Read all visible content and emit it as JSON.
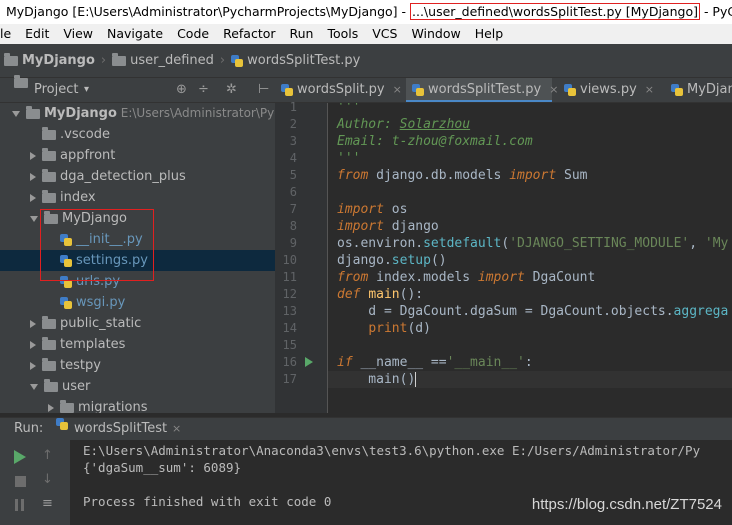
{
  "window": {
    "title_prefix": "MyDjango [E:\\Users\\Administrator\\PycharmProjects\\MyDjango] - ",
    "title_highlight": "...\\user_defined\\wordsSplitTest.py [MyDjango]",
    "title_suffix": " - PyCharm"
  },
  "menu": [
    "le",
    "Edit",
    "View",
    "Navigate",
    "Code",
    "Refactor",
    "Run",
    "Tools",
    "VCS",
    "Window",
    "Help"
  ],
  "breadcrumb": [
    "MyDjango",
    "user_defined",
    "wordsSplitTest.py"
  ],
  "project_panel": {
    "header_label": "Project",
    "tree": [
      {
        "label": "MyDjango",
        "suffix": "E:\\Users\\Administrator\\Pych",
        "type": "folder",
        "depth": 0,
        "expanded": true
      },
      {
        "label": ".vscode",
        "type": "folder",
        "depth": 1,
        "expanded": false,
        "no_arrow": true
      },
      {
        "label": "appfront",
        "type": "folder",
        "depth": 1,
        "expanded": false
      },
      {
        "label": "dga_detection_plus",
        "type": "folder",
        "depth": 1,
        "expanded": false
      },
      {
        "label": "index",
        "type": "folder",
        "depth": 1,
        "expanded": false
      },
      {
        "label": "MyDjango",
        "type": "folder",
        "depth": 1,
        "expanded": true
      },
      {
        "label": "__init__.py",
        "type": "py",
        "depth": 2
      },
      {
        "label": "settings.py",
        "type": "py",
        "depth": 2,
        "selected": true
      },
      {
        "label": "urls.py",
        "type": "py",
        "depth": 2
      },
      {
        "label": "wsgi.py",
        "type": "py",
        "depth": 2
      },
      {
        "label": "public_static",
        "type": "folder",
        "depth": 1,
        "expanded": false
      },
      {
        "label": "templates",
        "type": "folder",
        "depth": 1,
        "expanded": false
      },
      {
        "label": "testpy",
        "type": "folder",
        "depth": 1,
        "expanded": false
      },
      {
        "label": "user",
        "type": "folder",
        "depth": 1,
        "expanded": true
      },
      {
        "label": "migrations",
        "type": "folder",
        "depth": 2,
        "expanded": false
      }
    ]
  },
  "tabs": [
    {
      "label": "wordsSplit.py",
      "active": false
    },
    {
      "label": "wordsSplitTest.py",
      "active": true
    },
    {
      "label": "views.py",
      "active": false
    },
    {
      "label": "MyDjang",
      "active": false
    }
  ],
  "editor": {
    "line_numbers": [
      "1",
      "2",
      "3",
      "4",
      "5",
      "6",
      "7",
      "8",
      "9",
      "10",
      "11",
      "12",
      "13",
      "14",
      "15",
      "16",
      "17"
    ],
    "current_line": 17
  },
  "run_panel": {
    "label": "Run:",
    "config": "wordsSplitTest",
    "console": [
      "E:\\Users\\Administrator\\Anaconda3\\envs\\test3.6\\python.exe E:/Users/Administrator/Py",
      "{'dgaSum__sum': 6089}",
      "",
      "Process finished with exit code 0"
    ]
  },
  "watermark": "https://blog.csdn.net/ZT7524",
  "colors": {
    "accent": "#4a88c7",
    "highlight_box": "#e02020",
    "selection": "#0d293e"
  }
}
